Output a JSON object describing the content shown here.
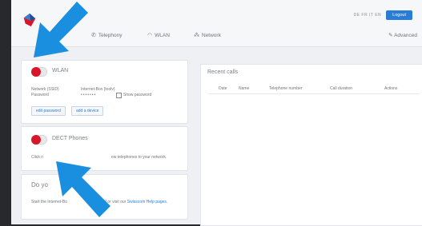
{
  "header": {
    "lang": "DE FR IT EN",
    "logout_label": "Logout",
    "nav": [
      {
        "label": "Telephony",
        "icon": "phone-icon"
      },
      {
        "label": "WLAN",
        "icon": "wifi-icon"
      },
      {
        "label": "Network",
        "icon": "network-icon"
      }
    ],
    "advanced_label": "Advanced"
  },
  "wlan": {
    "title": "WLAN",
    "network_label": "Network (SSID)",
    "password_label": "Password",
    "internet_box_label": "Internet-Box (toolv)",
    "password_value": "•••••••",
    "show_password_label": "Show password",
    "edit_password": "edit password",
    "add_device": "add a device",
    "toggle_state": "off"
  },
  "dect": {
    "title": "DECT Phones",
    "text_start": "Click n",
    "text_end": "ew telephones to your network.",
    "toggle_state": "off"
  },
  "tutorial": {
    "title": "Do yo",
    "text_a": "Start the Internet-Bo",
    "text_b": "x tutorial or visit our ",
    "link": "Swisscom Help pages",
    "text_c": "."
  },
  "recent_calls": {
    "title": "Recent calls",
    "columns": [
      "Date",
      "Name",
      "Telephone number",
      "Call duration",
      "Actions"
    ]
  },
  "colors": {
    "accent": "#2a7dd6",
    "toggle_red": "#d9152a",
    "arrow_blue": "#1a8fe0"
  }
}
